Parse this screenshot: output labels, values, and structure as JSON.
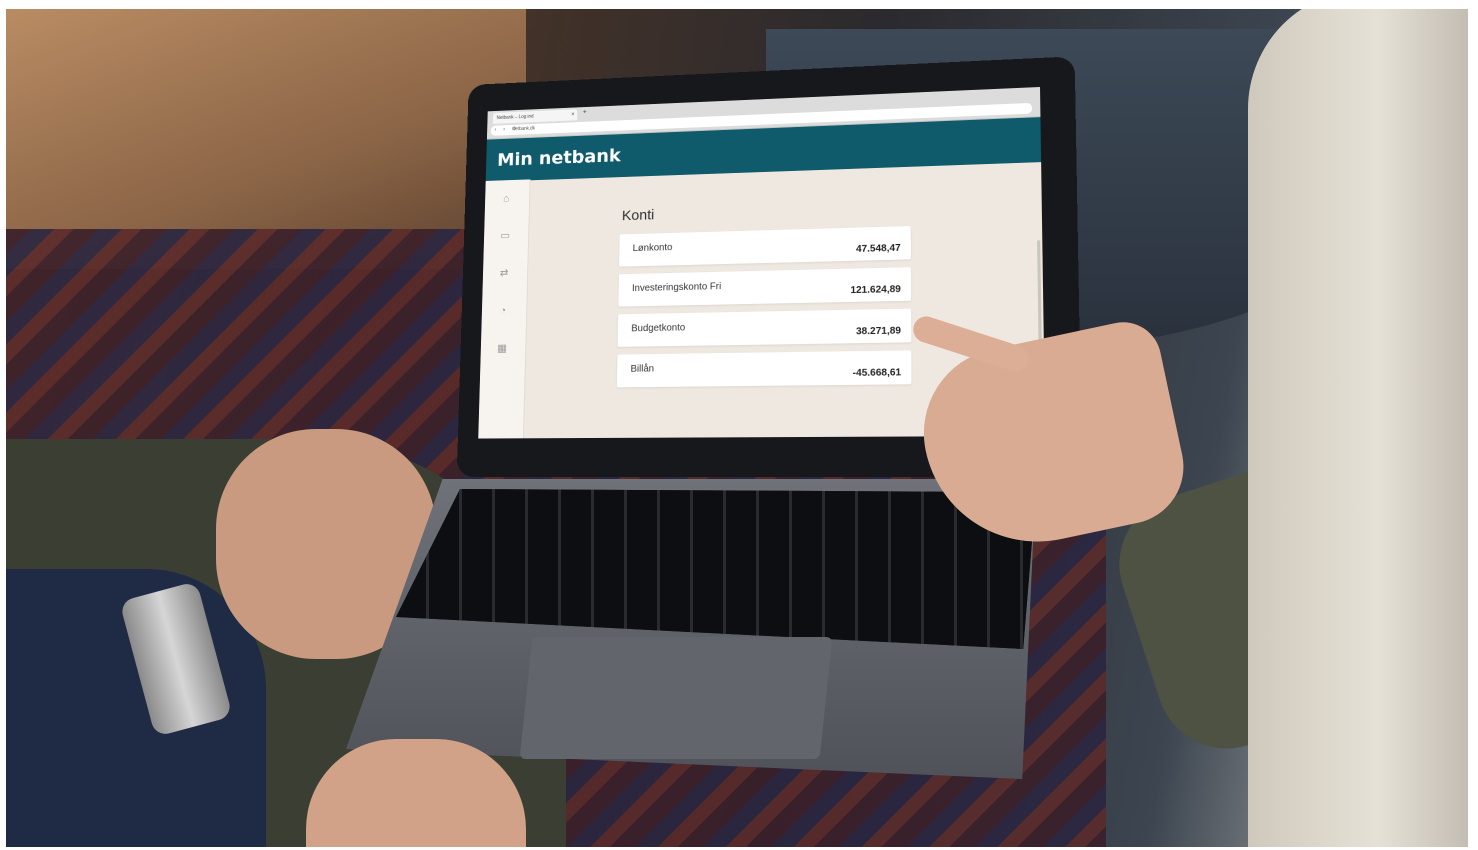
{
  "browser": {
    "tab_title": "Netbank – Log ind",
    "tab_close": "×",
    "new_tab": "+",
    "nav_icons": "‹ › ⟳",
    "url": "netbank.dk"
  },
  "app": {
    "title": "Min netbank"
  },
  "sidebar": {
    "icons": [
      "home-icon",
      "card-icon",
      "transfer-icon",
      "wallet-icon",
      "calendar-icon"
    ]
  },
  "accounts": {
    "title": "Konti",
    "items": [
      {
        "name": "Lønkonto",
        "amount": "47.548,47"
      },
      {
        "name": "Investeringskonto Fri",
        "amount": "121.624,89"
      },
      {
        "name": "Budgetkonto",
        "amount": "38.271,89"
      },
      {
        "name": "Billån",
        "amount": "-45.668,61"
      }
    ]
  },
  "colors": {
    "brand": "#0f5a6b",
    "screen_bg": "#eee8e0",
    "card_bg": "#ffffff"
  }
}
